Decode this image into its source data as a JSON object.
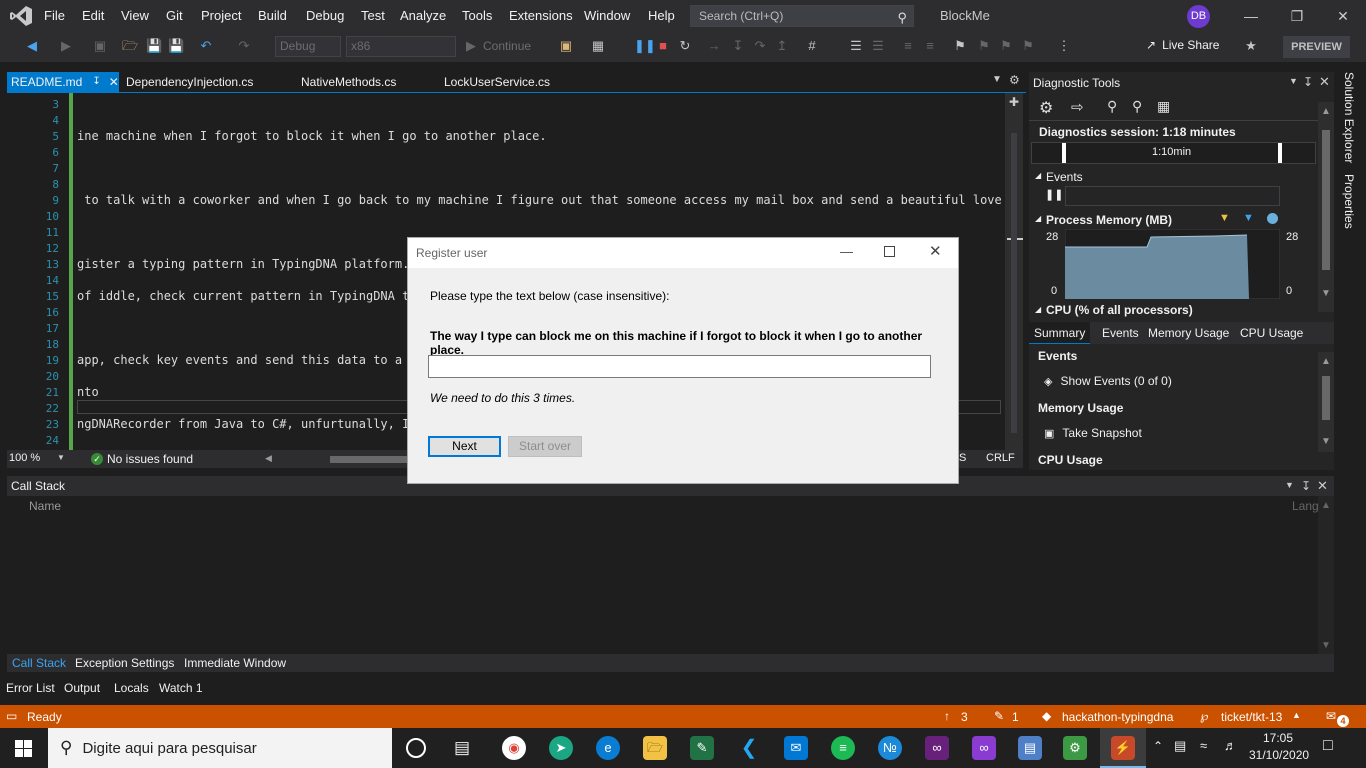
{
  "titlebar": {
    "menu": [
      "File",
      "Edit",
      "View",
      "Git",
      "Project",
      "Build",
      "Debug",
      "Test",
      "Analyze",
      "Tools",
      "Extensions",
      "Window",
      "Help"
    ],
    "search_placeholder": "Search (Ctrl+Q)",
    "solution_name": "BlockMe",
    "avatar_initials": "DB"
  },
  "toolbar": {
    "config": "Debug",
    "platform": "x86",
    "continue_label": "Continue",
    "live_share": "Live Share",
    "preview": "PREVIEW"
  },
  "tabs": [
    "README.md",
    "DependencyInjection.cs",
    "NativeMethods.cs",
    "LockUserService.cs"
  ],
  "editor": {
    "lines": [
      {
        "n": "3",
        "t": ""
      },
      {
        "n": "4",
        "t": ""
      },
      {
        "n": "5",
        "t": "ine machine when I forgot to block it when I go to another place."
      },
      {
        "n": "6",
        "t": ""
      },
      {
        "n": "7",
        "t": ""
      },
      {
        "n": "8",
        "t": ""
      },
      {
        "n": "9",
        "t": " to talk with a coworker and when I go back to my machine I figure out that someone access my mail box and send a beautiful love mess"
      },
      {
        "n": "10",
        "t": ""
      },
      {
        "n": "11",
        "t": ""
      },
      {
        "n": "12",
        "t": ""
      },
      {
        "n": "13",
        "t": "gister a typing pattern in TypingDNA platform."
      },
      {
        "n": "14",
        "t": ""
      },
      {
        "n": "15",
        "t": "of iddle, check current pattern in TypingDNA to"
      },
      {
        "n": "16",
        "t": ""
      },
      {
        "n": "17",
        "t": ""
      },
      {
        "n": "18",
        "t": ""
      },
      {
        "n": "19",
        "t": "app, check key events and send this data to a re"
      },
      {
        "n": "20",
        "t": ""
      },
      {
        "n": "21",
        "t": "nto"
      },
      {
        "n": "22",
        "t": ""
      },
      {
        "n": "23",
        "t": "ngDNARecorder from Java to C#, unfurtunally, I s"
      },
      {
        "n": "24",
        "t": ""
      }
    ],
    "zoom": "100 %",
    "issues": "No issues found",
    "line_ending": "CRLF",
    "encoding_partial": "S"
  },
  "dialog": {
    "title": "Register user",
    "prompt": "Please type the text below (case insensitive):",
    "text": "The way I type can block me on this machine if I forgot to block it when I go to another place.",
    "input_value": "",
    "note": "We need to do this 3 times.",
    "next": "Next",
    "start_over": "Start over"
  },
  "diag": {
    "title": "Diagnostic Tools",
    "session": "Diagnostics session: 1:18 minutes",
    "timeline": "1:10min",
    "events_label": "Events",
    "memory_label": "Process Memory (MB)",
    "mem_max_left": "28",
    "mem_min_left": "0",
    "mem_max_right": "28",
    "mem_min_right": "0",
    "cpu_label": "CPU (% of all processors)",
    "tabs": [
      "Summary",
      "Events",
      "Memory Usage",
      "CPU Usage"
    ],
    "events_section": "Events",
    "show_events": "Show Events (0 of 0)",
    "memory_section": "Memory Usage",
    "take_snapshot": "Take Snapshot",
    "cpu_section": "CPU Usage"
  },
  "callstack": {
    "title": "Call Stack",
    "col_name": "Name",
    "col_lang": "Lang"
  },
  "bottom_tabs1": [
    "Call Stack",
    "Exception Settings",
    "Immediate Window"
  ],
  "bottom_tabs2": [
    "Error List",
    "Output",
    "Locals",
    "Watch 1"
  ],
  "status": {
    "ready": "Ready",
    "up_count": "3",
    "edit_count": "1",
    "repo": "hackathon-typingdna",
    "branch": "ticket/tkt-13",
    "notif": "4"
  },
  "sidepanel": [
    "Solution Explorer",
    "Properties"
  ],
  "taskbar": {
    "search_placeholder": "Digite aqui para pesquisar",
    "time": "17:05",
    "date": "31/10/2020"
  },
  "colors": {
    "accent": "#007acc",
    "status": "#ca5100",
    "vs_purple": "#68217a"
  }
}
